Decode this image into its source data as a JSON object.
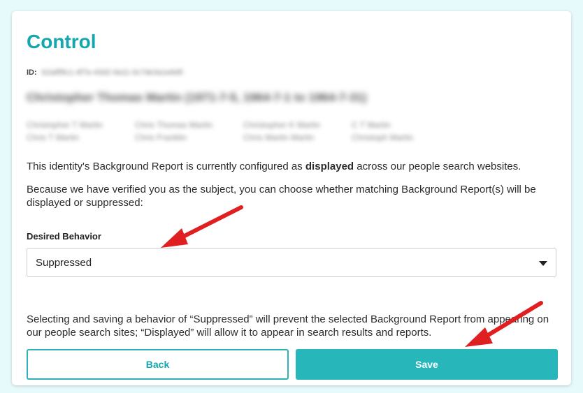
{
  "card": {
    "title": "Control",
    "id_label": "ID:",
    "id_value": "b2a8f9c1-4f7e-43d2-9a11-0c7de3a1e6d5",
    "name_line": "Christopher Thomas Martin (1971-7-5, 1964-7-1 to 1964-7-31)",
    "aliases": [
      "Christopher T Martin",
      "Chris Thomas Martin",
      "Christopher K Martin",
      "C T Martin",
      "Chris T Martin",
      "Chris Franklin",
      "Chris Martin Martin",
      "Christoph Martin"
    ],
    "status_prefix": "This identity's Background Report is currently configured as",
    "status_value": "displayed",
    "status_suffix": "across our people search websites.",
    "verified_text": "Because we have verified you as the subject, you can choose whether matching Background Report(s) will be displayed or suppressed:",
    "field_label": "Desired Behavior",
    "select_value": "Suppressed",
    "help_text": "Selecting and saving a behavior of “Suppressed” will prevent the selected Background Report from appearing on our people search sites; “Displayed” will allow it to appear in search results and reports.",
    "back_label": "Back",
    "save_label": "Save"
  },
  "colors": {
    "accent": "#14a7ad",
    "button_fill": "#27b6b9",
    "page_bg": "#e6f9fb",
    "annotation_arrow": "#e02020"
  }
}
